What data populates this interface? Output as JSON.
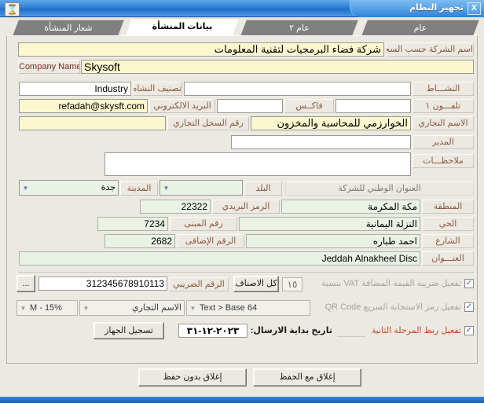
{
  "window": {
    "title": "تجهيز النظام",
    "close_label": "X",
    "app_icon": "hourglass-icon"
  },
  "tabs": [
    {
      "label": "عام",
      "active": false
    },
    {
      "label": "عام ٢",
      "active": false
    },
    {
      "label": "بيانات المنشأة",
      "active": true
    },
    {
      "label": "شعار المنشأة",
      "active": false
    }
  ],
  "form": {
    "company_name_registry_label": "اسم الشركة حسب السجل",
    "company_name_registry_value": "شركة فضاء البرمجيات لتقنية المعلومات",
    "company_name_en_label": "Company Name",
    "company_name_en_value": "Skysoft",
    "activity_label": "النشـــاط",
    "activity_value": "",
    "activity_class_label": "تصنيف النشاط",
    "activity_class_value": "Industry",
    "phone_label": "تلفـــون ١",
    "phone_value": "",
    "fax_label": "فاكــس",
    "fax_value": "",
    "email_label": "البريد الالكتروني",
    "email_value": "refadah@skysft.com",
    "trade_name_label": "الاسم التجاري",
    "trade_name_value": "الخوارزمي للمحاسبة والمخزون",
    "cr_number_label": "رقم السجل التجاري",
    "cr_number_value": "",
    "manager_label": "المدير",
    "manager_value": "",
    "notes_label": "ملاحظـــات",
    "notes_value": "",
    "national_address_header": "العنوان الوطني للشركة",
    "country_label": "البلد",
    "country_value": "",
    "city_label": "المدينة",
    "city_value": "جدة",
    "region_label": "المنطقة",
    "region_value": "مكة المكرمة",
    "postal_code_label": "الرمز البريدي",
    "postal_code_value": "22322",
    "district_label": "الحي",
    "district_value": "النزلة اليمانية",
    "building_no_label": "رقم المبنى",
    "building_no_value": "7234",
    "street_label": "الشارع",
    "street_value": "احمد طباره",
    "additional_no_label": "الرقم الإضافى",
    "additional_no_value": "2682",
    "address_label": "العنـــوان",
    "address_value": "Jeddah Alnakheel Disc"
  },
  "vat": {
    "enable_vat_label": "تفعيل ضريبة القيمة المضافة VAT بنسبة",
    "enable_vat_checked": true,
    "vat_percent": "١٥",
    "all_items_button": "كل الاصناف",
    "tax_number_label": "الرقم الضريبي",
    "tax_number_value": "312345678910113",
    "browse_button": "...",
    "enable_qr_label": "تفعيل رمز الاستجابة السريع QR Code",
    "enable_qr_checked": true,
    "qr_encoding_value": "Text > Base 64",
    "qr_source_value": "الاسم التجاري",
    "qr_mode_value": "M - 15%",
    "enable_phase2_label": "تفعيل ربط المرحلة الثانية",
    "enable_phase2_checked": true,
    "send_start_date_label": "تاريخ بداية الارسال:",
    "send_start_date_value": "٢٠٢٣-١٢-٣١",
    "register_device_button": "تسجيل الجهاز"
  },
  "footer": {
    "save_close_button": "إغلاق مع الحفظ",
    "close_no_save_button": "إغلاق بدون حفظ"
  },
  "colors": {
    "titlebar_blue": "#2f7fd6",
    "yellow_field": "#fbf8cf",
    "green_field": "#e9f2e4",
    "label_brown": "#8a5a3b",
    "alert_red": "#c4492a",
    "tab_gray": "#808080"
  }
}
